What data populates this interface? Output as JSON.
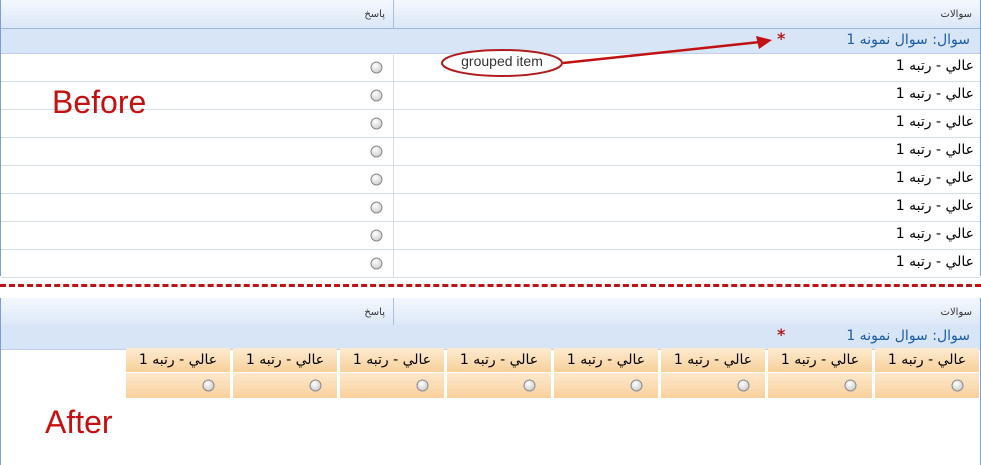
{
  "before": {
    "label": "Before",
    "header": {
      "questions": "سوالات",
      "answer": "پاسخ"
    },
    "question": {
      "prefix": "سوال:",
      "text": "سوال نمونه 1",
      "required_mark": "*"
    },
    "options": [
      "عالي - رتبه 1",
      "عالي - رتبه 1",
      "عالي - رتبه 1",
      "عالي - رتبه 1",
      "عالي - رتبه 1",
      "عالي - رتبه 1",
      "عالي - رتبه 1",
      "عالي - رتبه 1"
    ],
    "callout": "grouped item"
  },
  "after": {
    "label": "After",
    "header": {
      "questions": "سوالات",
      "answer": "پاسخ"
    },
    "question": {
      "prefix": "سوال:",
      "text": "سوال نمونه 1",
      "required_mark": "*"
    },
    "options": [
      "عالي - رتبه 1",
      "عالي - رتبه 1",
      "عالي - رتبه 1",
      "عالي - رتبه 1",
      "عالي - رتبه 1",
      "عالي - رتبه 1",
      "عالي - رتبه 1",
      "عالي - رتبه 1"
    ]
  },
  "colors": {
    "accent_red": "#c61010",
    "question_blue": "#1d5ba8",
    "cell_orange": "#f8cf98"
  }
}
